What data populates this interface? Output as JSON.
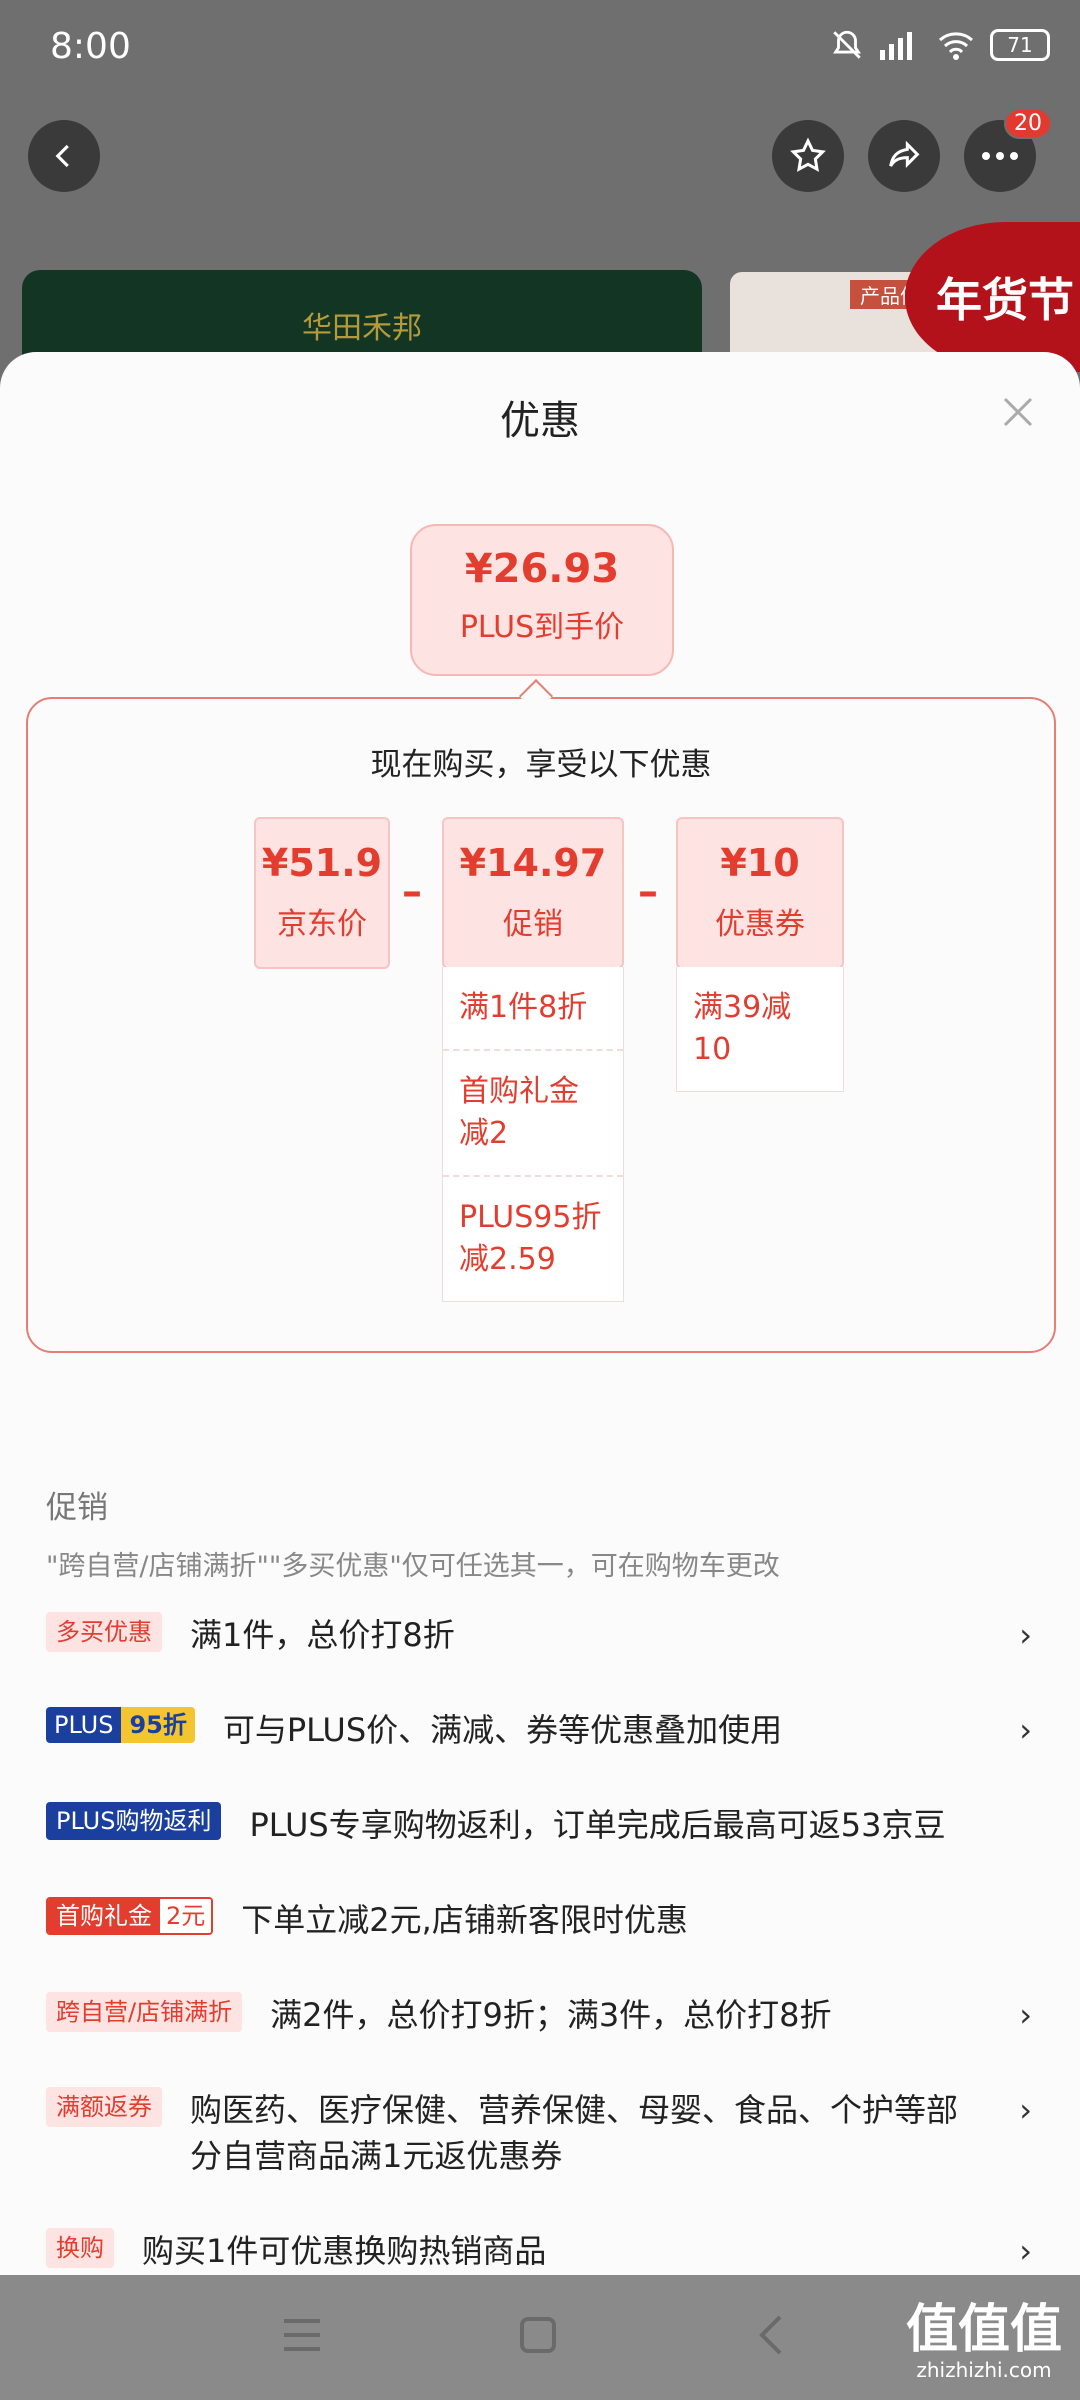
{
  "status_bar": {
    "time": "8:00",
    "battery": "71"
  },
  "background": {
    "badge_count": "20",
    "banner_brand": "华田禾邦",
    "product_tab": "产品信",
    "festival": "年货节"
  },
  "sheet": {
    "title": "优惠",
    "final_price": {
      "amount": "¥26.93",
      "label": "PLUS到手价"
    },
    "deal_header": "现在购买，享受以下优惠",
    "cards": [
      {
        "amount": "¥51.9",
        "label": "京东价"
      },
      {
        "amount": "¥14.97",
        "label": "促销"
      },
      {
        "amount": "¥10",
        "label": "优惠券"
      }
    ],
    "promo_breakdown": [
      "满1件8折",
      "首购礼金减2",
      "PLUS95折减2.59"
    ],
    "coupon_breakdown": [
      "满39减10"
    ],
    "promotions": {
      "section_title": "促销",
      "note": "\"跨自营/店铺满折\"\"多买优惠\"仅可任选其一，可在购物车更改",
      "items": [
        {
          "tag": "多买优惠",
          "text": "满1件，总价打8折"
        },
        {
          "tag_a": "PLUS",
          "tag_b": "95折",
          "text": "可与PLUS价、满减、券等优惠叠加使用"
        },
        {
          "tag": "PLUS购物返利",
          "text": "PLUS专享购物返利，订单完成后最高可返53京豆"
        },
        {
          "tag_a": "首购礼金",
          "tag_b": "2元",
          "text": "下单立减2元,店铺新客限时优惠"
        },
        {
          "tag": "跨自营/店铺满折",
          "text": "满2件，总价打9折；满3件，总价打8折"
        },
        {
          "tag": "满额返券",
          "text": "购医药、医疗保健、营养保健、母婴、食品、个护等部分自营商品满1元返优惠券"
        },
        {
          "tag": "换购",
          "text": "购买1件可优惠换购热销商品"
        }
      ]
    }
  },
  "watermark": {
    "big": "值值值",
    "small": "zhizhizhi.com"
  }
}
